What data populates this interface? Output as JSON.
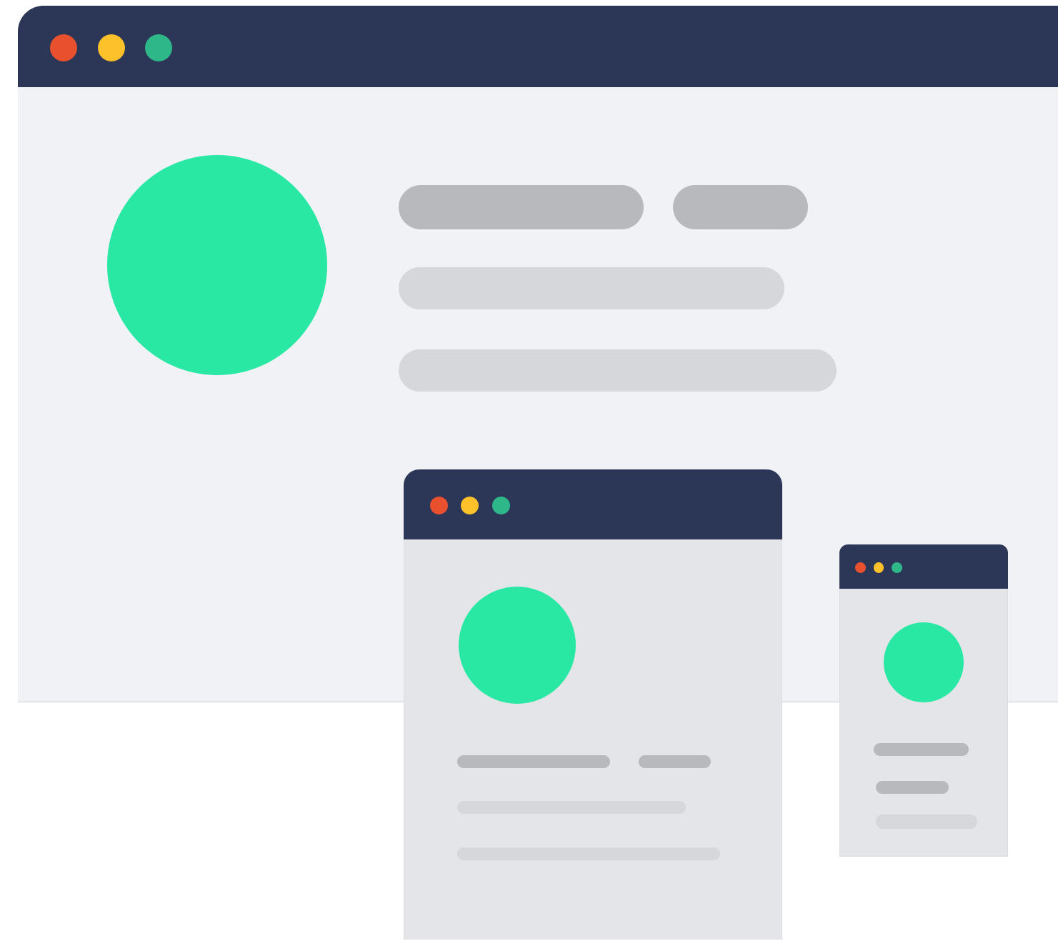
{
  "colors": {
    "titlebar": "#2c3656",
    "close": "#e8502e",
    "minimize": "#fdc229",
    "maximize": "#2eb88a",
    "avatar": "#29e8a4",
    "content_bg_large": "#f1f2f6",
    "content_bg_small": "#e4e5e9",
    "line_dark": "#b8b9bd",
    "line_light": "#d6d7db"
  },
  "windows": [
    {
      "id": "desktop",
      "icons": [
        "avatar-icon"
      ],
      "placeholder_lines": 4
    },
    {
      "id": "tablet",
      "icons": [
        "avatar-icon"
      ],
      "placeholder_lines": 4
    },
    {
      "id": "mobile",
      "icons": [
        "avatar-icon"
      ],
      "placeholder_lines": 3
    }
  ]
}
